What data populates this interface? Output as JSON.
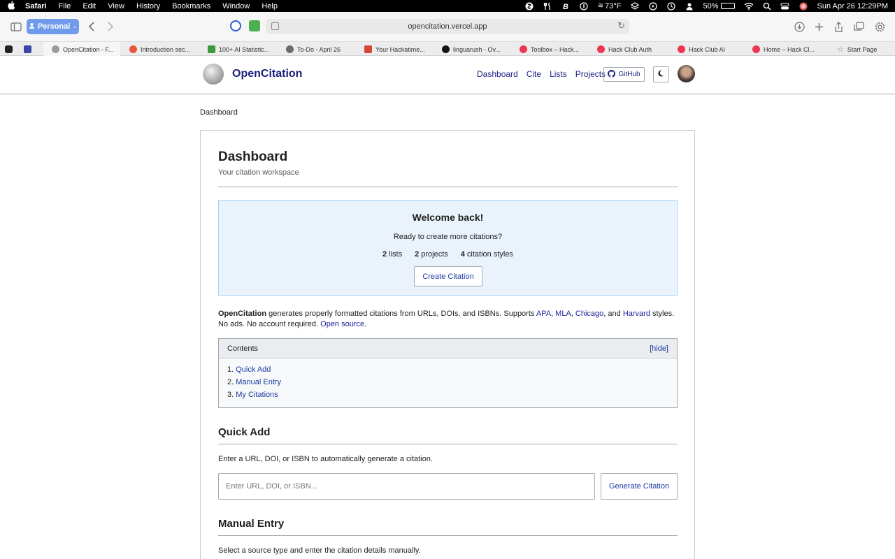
{
  "menubar": {
    "app": "Safari",
    "items": [
      "File",
      "Edit",
      "View",
      "History",
      "Bookmarks",
      "Window",
      "Help"
    ],
    "weather": "73°F",
    "battery": "50%",
    "battery_level": 0.5,
    "datetime": "Sun Apr 26  12:29PM"
  },
  "toolbar": {
    "profile": "Personal",
    "url": "opencitation.vercel.app"
  },
  "tabs": [
    {
      "label": "OpenCitation - F...",
      "color": "#9a9a9a"
    },
    {
      "label": "Introduction sec...",
      "color": "#e8553a"
    },
    {
      "label": "100+ AI Statistic...",
      "color": "#3c9a3c"
    },
    {
      "label": "To-Do - April 26",
      "color": "#6a6a6a"
    },
    {
      "label": "Your Hackatime...",
      "color": "#d44638"
    },
    {
      "label": "linguarush - Ov...",
      "color": "#111111"
    },
    {
      "label": "Toolbox – Hack...",
      "color": "#ec3750"
    },
    {
      "label": "Hack Club Auth",
      "color": "#ec3750"
    },
    {
      "label": "Hack Club AI",
      "color": "#ec3750"
    },
    {
      "label": "Home – Hack Cl...",
      "color": "#ec3750"
    },
    {
      "label": "Start Page",
      "color": "#888888"
    }
  ],
  "site": {
    "brand": "OpenCitation",
    "nav": [
      "Dashboard",
      "Cite",
      "Lists",
      "Projects"
    ],
    "github": "GitHub"
  },
  "breadcrumb": "Dashboard",
  "dashboard": {
    "title": "Dashboard",
    "subtitle": "Your citation workspace",
    "welcome": {
      "title": "Welcome back!",
      "subtitle": "Ready to create more citations?",
      "stats": [
        {
          "count": "2",
          "label": "lists"
        },
        {
          "count": "2",
          "label": "projects"
        },
        {
          "count": "4",
          "label": "citation styles"
        }
      ],
      "button": "Create Citation"
    },
    "intro": {
      "brand": "OpenCitation",
      "text1": " generates properly formatted citations from URLs, DOIs, and ISBNs. Supports ",
      "apa": "APA",
      "sep1": ", ",
      "mla": "MLA",
      "sep2": ", ",
      "chicago": "Chicago",
      "sep3": ", and ",
      "harvard": "Harvard",
      "text2": " styles. No ads. No account required. ",
      "open_source": "Open source",
      "end": "."
    },
    "toc": {
      "title": "Contents",
      "hide": "[hide]",
      "items": [
        {
          "num": "1.",
          "label": "Quick Add"
        },
        {
          "num": "2.",
          "label": "Manual Entry"
        },
        {
          "num": "3.",
          "label": "My Citations"
        }
      ]
    },
    "quick_add": {
      "heading": "Quick Add",
      "desc": "Enter a URL, DOI, or ISBN to automatically generate a citation.",
      "placeholder": "Enter URL, DOI, or ISBN...",
      "button": "Generate Citation"
    },
    "manual_entry": {
      "heading": "Manual Entry",
      "desc": "Select a source type and enter the citation details manually."
    }
  }
}
